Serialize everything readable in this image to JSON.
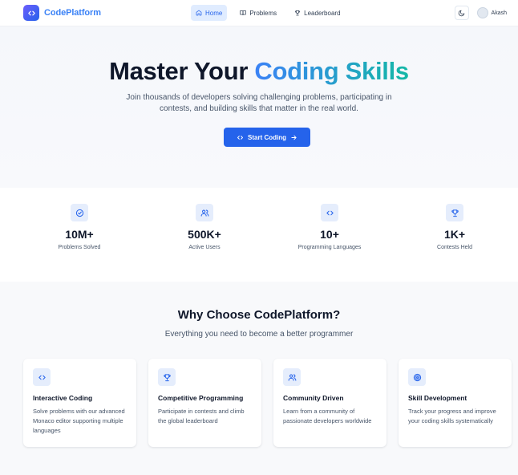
{
  "header": {
    "brand": "CodePlatform",
    "nav": [
      {
        "label": "Home",
        "icon": "home-icon",
        "active": true
      },
      {
        "label": "Problems",
        "icon": "book-icon",
        "active": false
      },
      {
        "label": "Leaderboard",
        "icon": "trophy-icon",
        "active": false
      }
    ],
    "theme_icon": "moon-icon",
    "user_name": "Akash"
  },
  "hero": {
    "title_plain": "Master Your",
    "title_highlight": "Coding Skills",
    "subtitle": "Join thousands of developers solving challenging problems, participating in contests, and building skills that matter in the real world.",
    "cta_label": "Start Coding",
    "cta_icon": "code-icon",
    "cta_arrow_icon": "arrow-right-icon"
  },
  "stats": [
    {
      "value": "10M+",
      "label": "Problems Solved",
      "icon": "check-circle-icon"
    },
    {
      "value": "500K+",
      "label": "Active Users",
      "icon": "users-icon"
    },
    {
      "value": "10+",
      "label": "Programming Languages",
      "icon": "code-icon"
    },
    {
      "value": "1K+",
      "label": "Contests Held",
      "icon": "trophy-icon"
    }
  ],
  "features": {
    "title": "Why Choose CodePlatform?",
    "subtitle": "Everything you need to become a better programmer",
    "cards": [
      {
        "title": "Interactive Coding",
        "description": "Solve problems with our advanced Monaco editor supporting multiple languages",
        "icon": "code-icon"
      },
      {
        "title": "Competitive Programming",
        "description": "Participate in contests and climb the global leaderboard",
        "icon": "trophy-icon"
      },
      {
        "title": "Community Driven",
        "description": "Learn from a community of passionate developers worldwide",
        "icon": "users-icon"
      },
      {
        "title": "Skill Development",
        "description": "Track your progress and improve your coding skills systematically",
        "icon": "target-icon"
      }
    ]
  },
  "colors": {
    "primary": "#2563eb",
    "brand_text": "#3b82f6",
    "gradient_end": "#14b8a6",
    "icon_bg": "#e5edfc"
  }
}
